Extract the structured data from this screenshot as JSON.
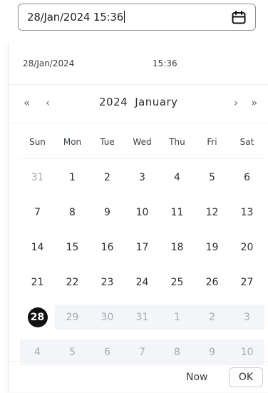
{
  "input": {
    "value": "28/Jan/2024 15:36"
  },
  "selection": {
    "date": "28/Jan/2024",
    "time": "15:36"
  },
  "nav": {
    "prev_year": "«",
    "prev_month": "‹",
    "year": "2024",
    "month": "January",
    "next_month": "›",
    "next_year": "»"
  },
  "weekdays": [
    "Sun",
    "Mon",
    "Tue",
    "Wed",
    "Thu",
    "Fri",
    "Sat"
  ],
  "weeks": [
    [
      "31",
      "1",
      "2",
      "3",
      "4",
      "5",
      "6"
    ],
    [
      "7",
      "8",
      "9",
      "10",
      "11",
      "12",
      "13"
    ],
    [
      "14",
      "15",
      "16",
      "17",
      "18",
      "19",
      "20"
    ],
    [
      "21",
      "22",
      "23",
      "24",
      "25",
      "26",
      "27"
    ],
    [
      "28",
      "29",
      "30",
      "31",
      "1",
      "2",
      "3"
    ],
    [
      "4",
      "5",
      "6",
      "7",
      "8",
      "9",
      "10"
    ]
  ],
  "footer": {
    "now_label": "Now",
    "ok_label": "OK"
  },
  "icons": {
    "calendar": "calendar-icon"
  }
}
